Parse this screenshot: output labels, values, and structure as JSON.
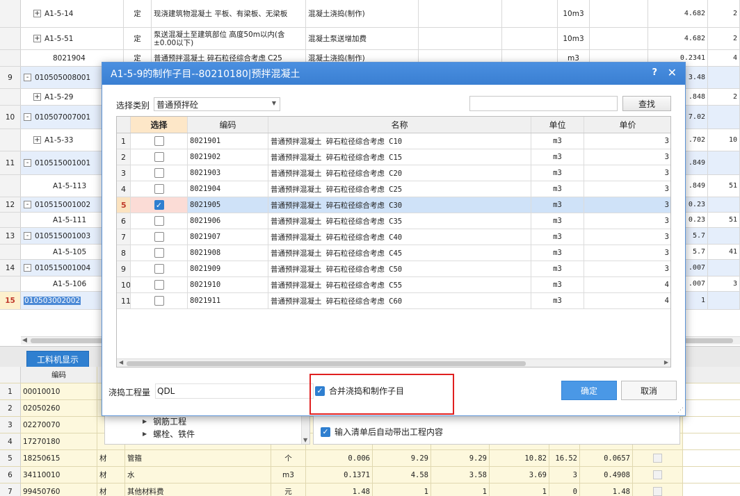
{
  "background_rows": [
    {
      "num": "",
      "code": "A1-5-14",
      "tree": "+",
      "indent": 1,
      "type": "定",
      "name": "现浇建筑物混凝土 平板、有梁板、无梁板",
      "feature": "混凝土浇捣(制作)",
      "unit": "10m3",
      "qty": "4.682",
      "extra": "2"
    },
    {
      "num": "",
      "code": "A1-5-51",
      "tree": "+",
      "indent": 1,
      "type": "定",
      "name": "泵送混凝土至建筑部位 高度50m以内(含±0.00以下)",
      "feature": "混凝土泵送增加费",
      "unit": "10m3",
      "qty": "4.682",
      "extra": "2"
    },
    {
      "num": "",
      "code": "8021904",
      "tree": "",
      "indent": 2,
      "type": "定",
      "name": "普通预拌混凝土 碎石粒径综合考虑 C25",
      "feature": "混凝土浇捣(制作)",
      "unit": "m3",
      "qty": "0.2341",
      "extra": "4"
    },
    {
      "num": "9",
      "code": "010505008001",
      "tree": "-",
      "indent": 0,
      "type": "",
      "name": "",
      "feature": "",
      "unit": "",
      "qty": "3.48",
      "extra": ""
    },
    {
      "num": "",
      "code": "A1-5-29",
      "tree": "+",
      "indent": 1,
      "type": "",
      "name": "",
      "feature": "",
      "unit": "",
      "qty": ".848",
      "extra": "2"
    },
    {
      "num": "10",
      "code": "010507007001",
      "tree": "-",
      "indent": 0,
      "type": "",
      "name": "",
      "feature": "",
      "unit": "",
      "qty": "7.02",
      "extra": ""
    },
    {
      "num": "",
      "code": "A1-5-33",
      "tree": "+",
      "indent": 1,
      "type": "",
      "name": "",
      "feature": "",
      "unit": "",
      "qty": ".702",
      "extra": "10"
    },
    {
      "num": "11",
      "code": "010515001001",
      "tree": "-",
      "indent": 0,
      "type": "",
      "name": "",
      "feature": "",
      "unit": "",
      "qty": ".849",
      "extra": ""
    },
    {
      "num": "",
      "code": "A1-5-113",
      "tree": "",
      "indent": 2,
      "type": "",
      "name": "",
      "feature": "",
      "unit": "",
      "qty": ".849",
      "extra": "51"
    },
    {
      "num": "12",
      "code": "010515001002",
      "tree": "-",
      "indent": 0,
      "type": "",
      "name": "",
      "feature": "",
      "unit": "",
      "qty": "0.23",
      "extra": ""
    },
    {
      "num": "",
      "code": "A1-5-111",
      "tree": "",
      "indent": 2,
      "type": "",
      "name": "",
      "feature": "",
      "unit": "",
      "qty": "0.23",
      "extra": "51"
    },
    {
      "num": "13",
      "code": "010515001003",
      "tree": "-",
      "indent": 0,
      "type": "",
      "name": "",
      "feature": "",
      "unit": "",
      "qty": "5.7",
      "extra": ""
    },
    {
      "num": "",
      "code": "A1-5-105",
      "tree": "",
      "indent": 2,
      "type": "",
      "name": "",
      "feature": "",
      "unit": "",
      "qty": "5.7",
      "extra": "41"
    },
    {
      "num": "14",
      "code": "010515001004",
      "tree": "-",
      "indent": 0,
      "type": "",
      "name": "",
      "feature": "",
      "unit": "",
      "qty": ".007",
      "extra": ""
    },
    {
      "num": "",
      "code": "A1-5-106",
      "tree": "",
      "indent": 2,
      "type": "",
      "name": "",
      "feature": "",
      "unit": "",
      "qty": ".007",
      "extra": "3"
    },
    {
      "num": "15",
      "code": "010503002002",
      "tree": "",
      "indent": 0,
      "type": "",
      "name": "",
      "feature": "",
      "unit": "",
      "qty": "1",
      "extra": ""
    }
  ],
  "bottom": {
    "tab_label": "工料机显示",
    "header_code": "编码",
    "rows": [
      {
        "num": "1",
        "code": "00010010",
        "type": "",
        "name": "",
        "unit": "",
        "v1": "",
        "v2": "",
        "v3": "",
        "v4": "",
        "v5": "",
        "v6": ""
      },
      {
        "num": "2",
        "code": "02050260",
        "type": "",
        "name": "",
        "unit": "",
        "v1": "",
        "v2": "",
        "v3": "",
        "v4": "",
        "v5": "",
        "v6": ""
      },
      {
        "num": "3",
        "code": "02270070",
        "type": "",
        "name": "",
        "unit": "",
        "v1": "",
        "v2": "",
        "v3": "",
        "v4": "",
        "v5": "",
        "v6": ""
      },
      {
        "num": "4",
        "code": "17270180",
        "type": "",
        "name": "",
        "unit": "",
        "v1": "",
        "v2": "",
        "v3": "",
        "v4": "",
        "v5": "",
        "v6": ""
      },
      {
        "num": "5",
        "code": "18250615",
        "type": "材",
        "name": "管箍",
        "unit": "个",
        "v1": "0.006",
        "v2": "9.29",
        "v3": "9.29",
        "v4": "10.82",
        "v5": "16.52",
        "v6": "0.0657"
      },
      {
        "num": "6",
        "code": "34110010",
        "type": "材",
        "name": "水",
        "unit": "m3",
        "v1": "0.1371",
        "v2": "4.58",
        "v3": "3.58",
        "v4": "3.69",
        "v5": "3",
        "v6": "0.4908"
      },
      {
        "num": "7",
        "code": "99450760",
        "type": "材",
        "name": "其他材料费",
        "unit": "元",
        "v1": "1.48",
        "v2": "1",
        "v3": "1",
        "v4": "1",
        "v5": "0",
        "v6": "1.48"
      }
    ]
  },
  "modal": {
    "title": "A1-5-9的制作子目--80210180|预拌混凝土",
    "help": "?",
    "close": "✕",
    "category_label": "选择类别",
    "category_value": "普通预拌砼",
    "search_value": "",
    "search_button": "查找",
    "columns": {
      "select": "选择",
      "code": "编码",
      "name": "名称",
      "unit": "单位",
      "price": "单价"
    },
    "rows": [
      {
        "num": "1",
        "checked": false,
        "code": "8021901",
        "name": "普通预拌混凝土 碎石粒径综合考虑 C10",
        "unit": "m3",
        "price": "3"
      },
      {
        "num": "2",
        "checked": false,
        "code": "8021902",
        "name": "普通预拌混凝土 碎石粒径综合考虑 C15",
        "unit": "m3",
        "price": "3"
      },
      {
        "num": "3",
        "checked": false,
        "code": "8021903",
        "name": "普通预拌混凝土 碎石粒径综合考虑 C20",
        "unit": "m3",
        "price": "3"
      },
      {
        "num": "4",
        "checked": false,
        "code": "8021904",
        "name": "普通预拌混凝土 碎石粒径综合考虑 C25",
        "unit": "m3",
        "price": "3"
      },
      {
        "num": "5",
        "checked": true,
        "code": "8021905",
        "name": "普通预拌混凝土 碎石粒径综合考虑 C30",
        "unit": "m3",
        "price": "3"
      },
      {
        "num": "6",
        "checked": false,
        "code": "8021906",
        "name": "普通预拌混凝土 碎石粒径综合考虑 C35",
        "unit": "m3",
        "price": "3"
      },
      {
        "num": "7",
        "checked": false,
        "code": "8021907",
        "name": "普通预拌混凝土 碎石粒径综合考虑 C40",
        "unit": "m3",
        "price": "3"
      },
      {
        "num": "8",
        "checked": false,
        "code": "8021908",
        "name": "普通预拌混凝土 碎石粒径综合考虑 C45",
        "unit": "m3",
        "price": "3"
      },
      {
        "num": "9",
        "checked": false,
        "code": "8021909",
        "name": "普通预拌混凝土 碎石粒径综合考虑 C50",
        "unit": "m3",
        "price": "3"
      },
      {
        "num": "10",
        "checked": false,
        "code": "8021910",
        "name": "普通预拌混凝土 碎石粒径综合考虑 C55",
        "unit": "m3",
        "price": "4"
      },
      {
        "num": "11",
        "checked": false,
        "code": "8021911",
        "name": "普通预拌混凝土 碎石粒径综合考虑 C60",
        "unit": "m3",
        "price": "4"
      }
    ],
    "qty_label": "浇捣工程量",
    "qty_value": "QDL",
    "merge_label": "合并浇捣和制作子目",
    "merge_checked": true,
    "ok_button": "确定",
    "cancel_button": "取消"
  },
  "tree_panel": {
    "items": [
      "钢筋工程",
      "螺栓、铁件"
    ]
  },
  "options": {
    "auto_content_label": "输入清单后自动带出工程内容",
    "auto_content_checked": true
  },
  "colors": {
    "accent": "#2f7fd0",
    "title_bar": "#3a7fd2",
    "selected_row": "#cfe2f8",
    "highlight_box": "#e02020"
  }
}
